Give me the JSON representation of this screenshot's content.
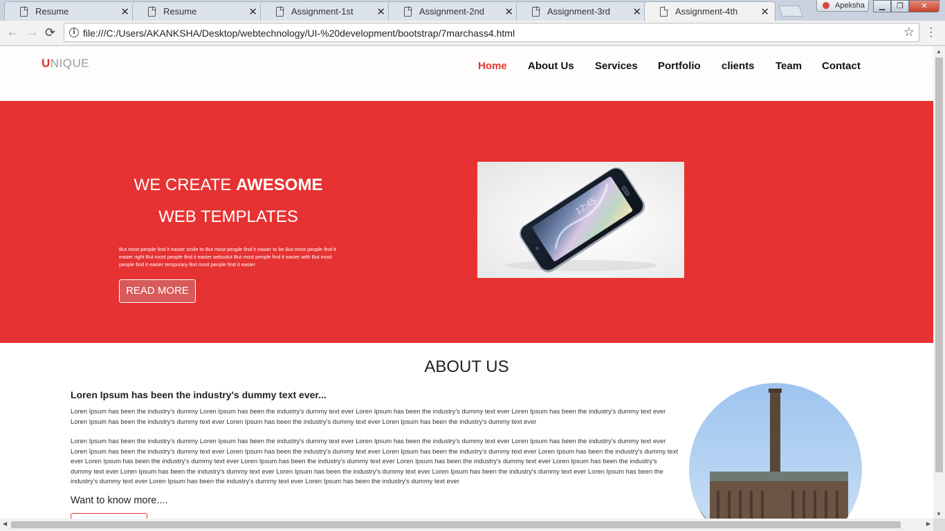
{
  "browser": {
    "tabs": [
      {
        "title": "Resume",
        "active": false
      },
      {
        "title": "Resume",
        "active": false
      },
      {
        "title": "Assignment-1st",
        "active": false
      },
      {
        "title": "Assignment-2nd",
        "active": false
      },
      {
        "title": "Assignment-3rd",
        "active": false
      },
      {
        "title": "Assignment-4th",
        "active": true
      }
    ],
    "profile_name": "Apeksha",
    "url": "file:///C:/Users/AKANKSHA/Desktop/webtechnology/UI-%20development/bootstrap/7marchass4.html",
    "icons": {
      "back": "back-arrow-icon",
      "forward": "forward-arrow-icon",
      "reload": "reload-icon",
      "info": "info-icon",
      "bookmark": "star-icon",
      "menu": "kebab-menu-icon"
    }
  },
  "site": {
    "logo": {
      "first": "U",
      "rest": "NIQUE"
    },
    "nav": [
      {
        "label": "Home",
        "active": true
      },
      {
        "label": "About Us",
        "active": false
      },
      {
        "label": "Services",
        "active": false
      },
      {
        "label": "Portfolio",
        "active": false
      },
      {
        "label": "clients",
        "active": false
      },
      {
        "label": "Team",
        "active": false
      },
      {
        "label": "Contact",
        "active": false
      }
    ],
    "hero": {
      "line1_prefix": "WE CREATE ",
      "line1_bold": "AWESOME",
      "line2": "WEB TEMPLATES",
      "paragraph": "But most people find it easier smile to But most people find it easier to be But most people find it easier right But most people find it easier aebsolut But most people find it easier with But most people find it easier temporary But most people find it easier",
      "button": "READ MORE"
    },
    "about": {
      "title": "ABOUT US",
      "subtitle": "Loren Ipsum has been the industry's dummy text ever...",
      "paragraph1": "Loren Ipsum has been the industry's dummy Loren Ipsum has been the industry's dummy text ever Loren Ipsum has been the industry's dummy text ever Loren Ipsum has been the industry's dummy text ever Loren Ipsum has been the industry's dummy text ever Loren Ipsum has been the industry's dummy text ever Loren Ipsum has been the industry's dummy text ever",
      "paragraph2": "Loren Ipsum has been the industry's dummy Loren Ipsum has been the industry's dummy text ever Loren Ipsum has been the industry's dummy text ever Loren Ipsum has been the industry's dummy text ever Loren Ipsum has been the industry's dummy text ever Loren Ipsum has been the industry's dummy text ever Loren Ipsum has been the industry's dummy text ever Loren Ipsum has been the industry's dummy text ever Loren Ipsum has been the industry's dummy text ever Loren Ipsum has been the industry's dummy text ever Loren Ipsum has been the industry's dummy text ever Loren Ipsum has been the industry's dummy text ever Loren Ipsum has been the industry's dummy text ever Loren Ipsum has been the industry's dummy text ever Loren Ipsum has been the industry's dummy text ever Loren Ipsum has been the industry's dummy text ever Loren Ipsum has been the industry's dummy text ever Loren Ipsum has been the industry's dummy text ever",
      "want_more": "Want to know more...."
    },
    "colors": {
      "accent": "#e63232",
      "header_bg": "#fffdfb",
      "text": "#111111"
    }
  }
}
